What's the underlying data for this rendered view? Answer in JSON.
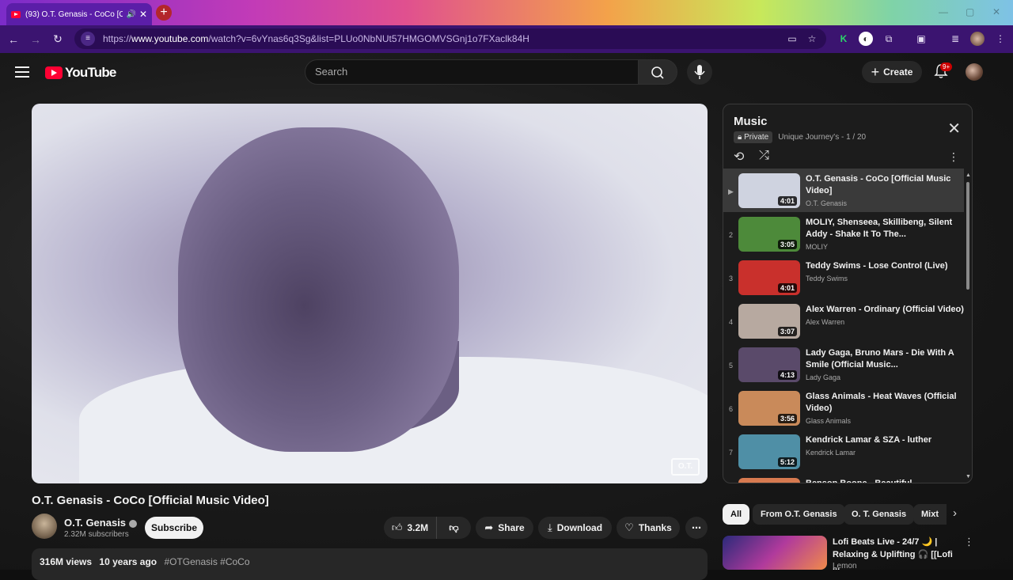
{
  "browser": {
    "tab_title": "(93) O.T. Genasis - CoCo [O",
    "url_prefix": "https://",
    "url_host": "www.youtube.com",
    "url_path": "/watch?v=6vYnas6q3Sg&list=PLUo0NbNUt57HMGOMVSGnj1o7FXaclk84H"
  },
  "header": {
    "logo_text": "YouTube",
    "search_placeholder": "Search",
    "create_label": "Create",
    "notif_badge": "9+"
  },
  "video": {
    "title": "O.T. Genasis - CoCo [Official Music Video]",
    "watermark": "O.T.",
    "channel": "O.T. Genasis",
    "subscribers": "2.32M subscribers",
    "subscribe_label": "Subscribe",
    "likes": "3.2M",
    "share_label": "Share",
    "download_label": "Download",
    "thanks_label": "Thanks",
    "views": "316M views",
    "age": "10 years ago",
    "tags": "#OTGenasis #CoCo"
  },
  "playlist": {
    "title": "Music",
    "privacy": "Private",
    "owner": "Unique Journey's",
    "position": "- 1 / 20",
    "items": [
      {
        "index": "▶",
        "title": "O.T. Genasis - CoCo [Official Music Video]",
        "channel": "O.T. Genasis",
        "duration": "4:01",
        "color": "#cfd3e0"
      },
      {
        "index": "2",
        "title": "MOLIY, Shenseea, Skillibeng, Silent Addy - Shake It To The...",
        "channel": "MOLIY",
        "duration": "3:05",
        "color": "#4d8a3a"
      },
      {
        "index": "3",
        "title": "Teddy Swims - Lose Control (Live)",
        "channel": "Teddy Swims",
        "duration": "4:01",
        "color": "#c9302c"
      },
      {
        "index": "4",
        "title": "Alex Warren - Ordinary (Official Video)",
        "channel": "Alex Warren",
        "duration": "3:07",
        "color": "#b7a9a0"
      },
      {
        "index": "5",
        "title": "Lady Gaga, Bruno Mars - Die With A Smile (Official Music...",
        "channel": "Lady Gaga",
        "duration": "4:13",
        "color": "#5a4a6a"
      },
      {
        "index": "6",
        "title": "Glass Animals - Heat Waves (Official Video)",
        "channel": "Glass Animals",
        "duration": "3:56",
        "color": "#c98a5a"
      },
      {
        "index": "7",
        "title": "Kendrick Lamar & SZA - luther",
        "channel": "Kendrick Lamar",
        "duration": "5:12",
        "color": "#4f8fa6"
      },
      {
        "index": "",
        "title": "Benson Boone - Beautiful",
        "channel": "",
        "duration": "",
        "color": "#d77a50"
      }
    ]
  },
  "chips": [
    "All",
    "From O.T. Genasis",
    "O. T. Genasis",
    "Mixt"
  ],
  "recommendation": {
    "title": "Lofi Beats Live - 24/7 🌙 | Relaxing & Uplifting 🎧 [[Lofi ...",
    "channel": "Lemon"
  }
}
